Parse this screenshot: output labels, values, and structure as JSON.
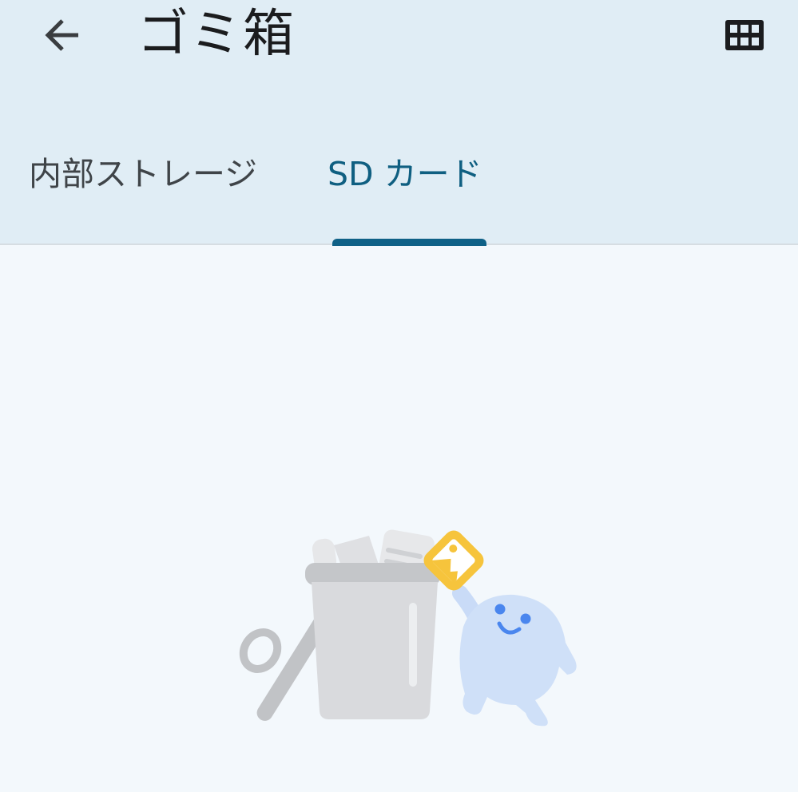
{
  "header": {
    "title": "ゴミ箱",
    "back_icon": "arrow-left-icon",
    "view_toggle_icon": "grid-view-icon"
  },
  "tabs": [
    {
      "label": "内部ストレージ",
      "selected": false
    },
    {
      "label": "SD カード",
      "selected": true
    }
  ],
  "colors": {
    "appbar_background": "#e0edf5",
    "page_background": "#f3f8fc",
    "active_tab": "#0f6187",
    "title_text": "#1b1c1e"
  },
  "empty_state": {
    "illustration_icon": "empty-trash-illustration"
  }
}
